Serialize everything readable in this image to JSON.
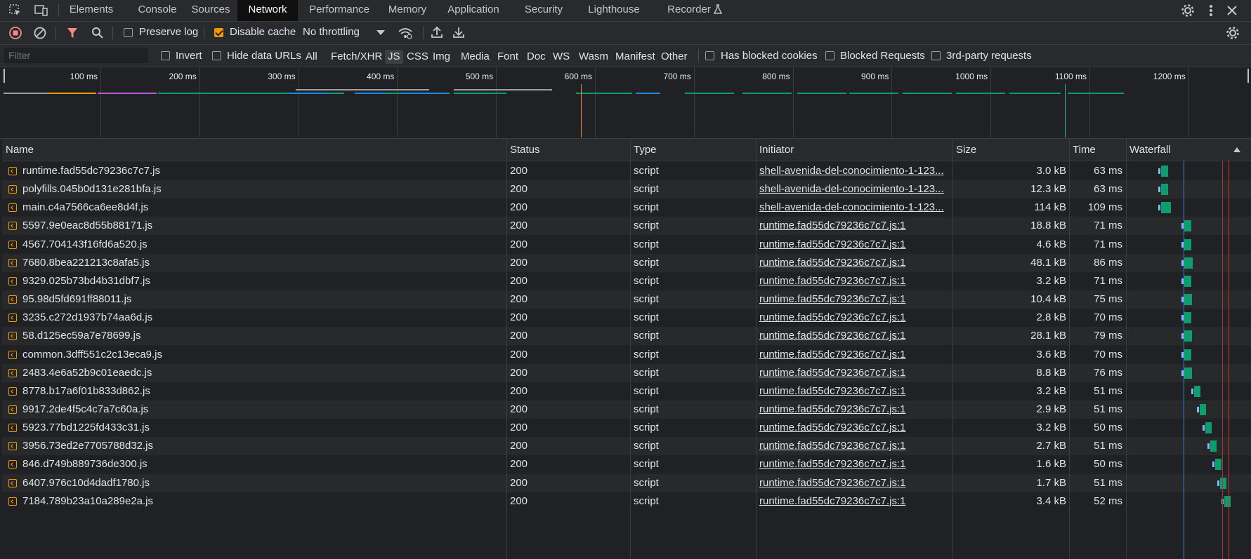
{
  "tabs": [
    "Elements",
    "Console",
    "Sources",
    "Network",
    "Performance",
    "Memory",
    "Application",
    "Security",
    "Lighthouse",
    "Recorder"
  ],
  "active_tab": "Network",
  "toolbar": {
    "preserve_log": "Preserve log",
    "disable_cache": "Disable cache",
    "throttling": "No throttling"
  },
  "filterbar": {
    "filter_placeholder": "Filter",
    "invert": "Invert",
    "hide_data_urls": "Hide data URLs",
    "types": [
      "All",
      "Fetch/XHR",
      "JS",
      "CSS",
      "Img",
      "Media",
      "Font",
      "Doc",
      "WS",
      "Wasm",
      "Manifest",
      "Other"
    ],
    "active_type": "JS",
    "has_blocked_cookies": "Has blocked cookies",
    "blocked_requests": "Blocked Requests",
    "third_party": "3rd-party requests"
  },
  "overview": {
    "ticks": [
      "100 ms",
      "200 ms",
      "300 ms",
      "400 ms",
      "500 ms",
      "600 ms",
      "700 ms",
      "800 ms",
      "900 ms",
      "1000 ms",
      "1100 ms",
      "1200 ms"
    ]
  },
  "columns": [
    "Name",
    "Status",
    "Type",
    "Initiator",
    "Size",
    "Time",
    "Waterfall"
  ],
  "rows": [
    {
      "name": "runtime.fad55dc79236c7c7.js",
      "status": "200",
      "type": "script",
      "initiator": "shell-avenida-del-conocimiento-1-123...",
      "size": "3.0 kB",
      "time": "63 ms"
    },
    {
      "name": "polyfills.045b0d131e281bfa.js",
      "status": "200",
      "type": "script",
      "initiator": "shell-avenida-del-conocimiento-1-123...",
      "size": "12.3 kB",
      "time": "63 ms"
    },
    {
      "name": "main.c4a7566ca6ee8d4f.js",
      "status": "200",
      "type": "script",
      "initiator": "shell-avenida-del-conocimiento-1-123...",
      "size": "114 kB",
      "time": "109 ms"
    },
    {
      "name": "5597.9e0eac8d55b88171.js",
      "status": "200",
      "type": "script",
      "initiator": "runtime.fad55dc79236c7c7.js:1",
      "size": "18.8 kB",
      "time": "71 ms"
    },
    {
      "name": "4567.704143f16fd6a520.js",
      "status": "200",
      "type": "script",
      "initiator": "runtime.fad55dc79236c7c7.js:1",
      "size": "4.6 kB",
      "time": "71 ms"
    },
    {
      "name": "7680.8bea221213c8afa5.js",
      "status": "200",
      "type": "script",
      "initiator": "runtime.fad55dc79236c7c7.js:1",
      "size": "48.1 kB",
      "time": "86 ms"
    },
    {
      "name": "9329.025b73bd4b31dbf7.js",
      "status": "200",
      "type": "script",
      "initiator": "runtime.fad55dc79236c7c7.js:1",
      "size": "3.2 kB",
      "time": "71 ms"
    },
    {
      "name": "95.98d5fd691ff88011.js",
      "status": "200",
      "type": "script",
      "initiator": "runtime.fad55dc79236c7c7.js:1",
      "size": "10.4 kB",
      "time": "75 ms"
    },
    {
      "name": "3235.c272d1937b74aa6d.js",
      "status": "200",
      "type": "script",
      "initiator": "runtime.fad55dc79236c7c7.js:1",
      "size": "2.8 kB",
      "time": "70 ms"
    },
    {
      "name": "58.d125ec59a7e78699.js",
      "status": "200",
      "type": "script",
      "initiator": "runtime.fad55dc79236c7c7.js:1",
      "size": "28.1 kB",
      "time": "79 ms"
    },
    {
      "name": "common.3dff551c2c13eca9.js",
      "status": "200",
      "type": "script",
      "initiator": "runtime.fad55dc79236c7c7.js:1",
      "size": "3.6 kB",
      "time": "70 ms"
    },
    {
      "name": "2483.4e6a52b9c01eaedc.js",
      "status": "200",
      "type": "script",
      "initiator": "runtime.fad55dc79236c7c7.js:1",
      "size": "8.8 kB",
      "time": "76 ms"
    },
    {
      "name": "8778.b17a6f01b833d862.js",
      "status": "200",
      "type": "script",
      "initiator": "runtime.fad55dc79236c7c7.js:1",
      "size": "3.2 kB",
      "time": "51 ms"
    },
    {
      "name": "9917.2de4f5c4c7a7c60a.js",
      "status": "200",
      "type": "script",
      "initiator": "runtime.fad55dc79236c7c7.js:1",
      "size": "2.9 kB",
      "time": "51 ms"
    },
    {
      "name": "5923.77bd1225fd433c31.js",
      "status": "200",
      "type": "script",
      "initiator": "runtime.fad55dc79236c7c7.js:1",
      "size": "3.2 kB",
      "time": "50 ms"
    },
    {
      "name": "3956.73ed2e7705788d32.js",
      "status": "200",
      "type": "script",
      "initiator": "runtime.fad55dc79236c7c7.js:1",
      "size": "2.7 kB",
      "time": "51 ms"
    },
    {
      "name": "846.d749b889736de300.js",
      "status": "200",
      "type": "script",
      "initiator": "runtime.fad55dc79236c7c7.js:1",
      "size": "1.6 kB",
      "time": "50 ms"
    },
    {
      "name": "6407.976c10d4dadf1780.js",
      "status": "200",
      "type": "script",
      "initiator": "runtime.fad55dc79236c7c7.js:1",
      "size": "1.7 kB",
      "time": "51 ms"
    },
    {
      "name": "7184.789b23a10a289e2a.js",
      "status": "200",
      "type": "script",
      "initiator": "runtime.fad55dc79236c7c7.js:1",
      "size": "3.4 kB",
      "time": "52 ms"
    }
  ]
}
